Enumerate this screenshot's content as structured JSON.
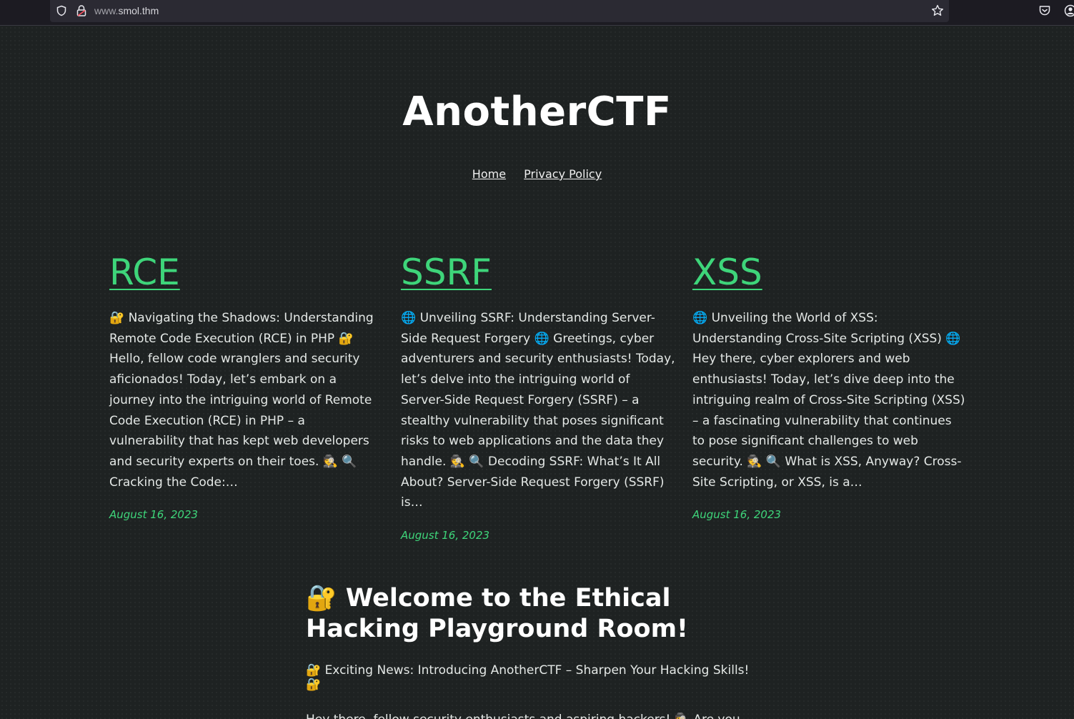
{
  "browser": {
    "url_prefix": "www.",
    "url_domain": "smol.thm"
  },
  "site": {
    "title": "AnotherCTF"
  },
  "nav": {
    "home": "Home",
    "privacy": "Privacy Policy"
  },
  "posts": [
    {
      "title": "RCE",
      "excerpt": "🔐 Navigating the Shadows: Understanding Remote Code Execution (RCE) in PHP 🔐 Hello, fellow code wranglers and security aficionados! Today, let’s embark on a journey into the intriguing world of Remote Code Execution (RCE) in PHP – a vulnerability that has kept web developers and security experts on their toes. 🕵 🔍 Cracking the Code:…",
      "date": "August 16, 2023"
    },
    {
      "title": "SSRF",
      "excerpt": "🌐 Unveiling SSRF: Understanding Server-Side Request Forgery 🌐 Greetings, cyber adventurers and security enthusiasts! Today, let’s delve into the intriguing world of Server-Side Request Forgery (SSRF) – a stealthy vulnerability that poses significant risks to web applications and the data they handle. 🕵 🔍 Decoding SSRF: What’s It All About? Server-Side Request Forgery (SSRF) is…",
      "date": "August 16, 2023"
    },
    {
      "title": "XSS",
      "excerpt": "🌐 Unveiling the World of XSS: Understanding Cross-Site Scripting (XSS) 🌐 Hey there, cyber explorers and web enthusiasts! Today, let’s dive deep into the intriguing realm of Cross-Site Scripting (XSS) – a fascinating vulnerability that continues to pose significant challenges to web security. 🕵 🔍 What is XSS, Anyway? Cross-Site Scripting, or XSS, is a…",
      "date": "August 16, 2023"
    }
  ],
  "feature": {
    "heading": "🔐 Welcome to the Ethical Hacking Playground Room!",
    "news": "🔐 Exciting News: Introducing AnotherCTF – Sharpen Your Hacking Skills! 🔐",
    "intro": "Hey there, fellow security enthusiasts and aspiring hackers! 🕵 Are you ready to"
  },
  "colors": {
    "accent": "#3ed57a",
    "background": "#1e2222",
    "text": "#e4e8e6"
  },
  "icons": [
    "shield-icon",
    "lock-icon",
    "star-icon",
    "pocket-icon",
    "account-icon"
  ]
}
